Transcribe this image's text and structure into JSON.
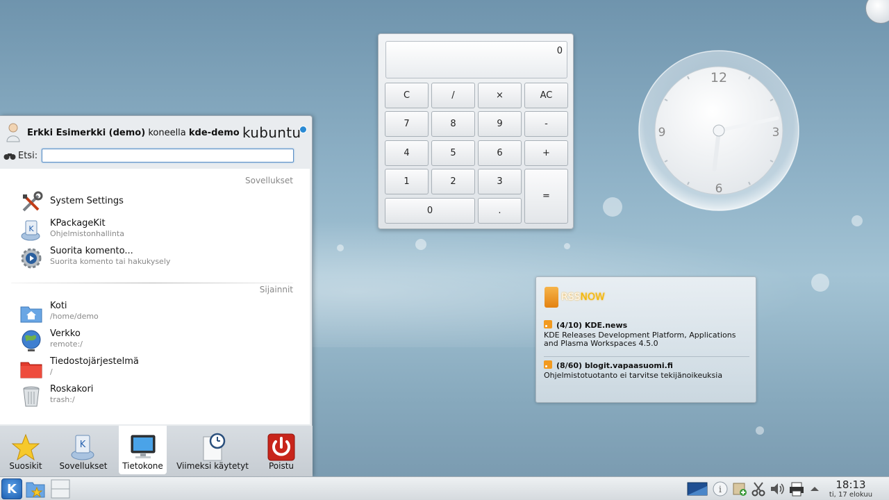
{
  "desktop": {
    "background_color": "#8fb2c7"
  },
  "calculator": {
    "display": "0",
    "buttons": {
      "c": "C",
      "div": "/",
      "mul": "×",
      "ac": "AC",
      "n7": "7",
      "n8": "8",
      "n9": "9",
      "minus": "-",
      "n4": "4",
      "n5": "5",
      "n6": "6",
      "plus": "+",
      "n1": "1",
      "n2": "2",
      "n3": "3",
      "eq": "=",
      "n0": "0",
      "dot": "."
    }
  },
  "clock": {
    "n12": "12",
    "n3": "3",
    "n6": "6",
    "n9": "9",
    "time": "18:13"
  },
  "rss": {
    "logo_a": "RSS",
    "logo_b": "NOW",
    "items": [
      {
        "title": "(4/10) KDE.news",
        "desc": "KDE Releases Development Platform, Applications and Plasma Workspaces 4.5.0"
      },
      {
        "title": "(8/60) blogit.vapaasuomi.fi",
        "desc": "Ohjelmistotuotanto ei tarvitse tekijänoikeuksia"
      }
    ]
  },
  "kickoff": {
    "user_name": "Erkki Esimerkki (demo)",
    "user_on": "koneella",
    "host": "kde-demo",
    "brand": "kubuntu",
    "search_label": "Etsi:",
    "search_value": "",
    "sections": {
      "apps": "Sovellukset",
      "places": "Sijainnit"
    },
    "apps": [
      {
        "title": "System Settings",
        "sub": ""
      },
      {
        "title": "KPackageKit",
        "sub": "Ohjelmistonhallinta"
      },
      {
        "title": "Suorita komento...",
        "sub": "Suorita komento tai hakukysely"
      }
    ],
    "places": [
      {
        "title": "Koti",
        "sub": "/home/demo"
      },
      {
        "title": "Verkko",
        "sub": "remote:/"
      },
      {
        "title": "Tiedostojärjestelmä",
        "sub": "/"
      },
      {
        "title": "Roskakori",
        "sub": "trash:/"
      }
    ],
    "tabs": [
      {
        "label": "Suosikit"
      },
      {
        "label": "Sovellukset"
      },
      {
        "label": "Tietokone"
      },
      {
        "label": "Viimeksi käytetyt"
      },
      {
        "label": "Poistu"
      }
    ],
    "active_tab": "Tietokone"
  },
  "panel": {
    "clock_time": "18:13",
    "clock_date": "ti, 17 elokuu"
  }
}
